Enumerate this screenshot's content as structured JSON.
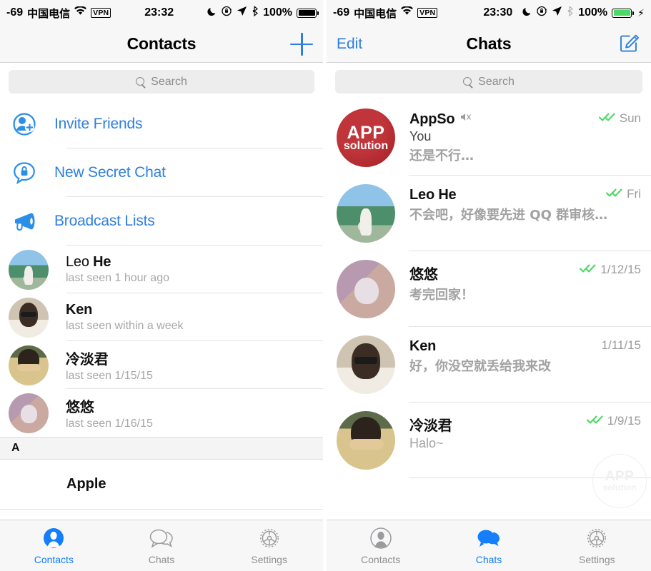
{
  "left": {
    "status": {
      "signal": "-69",
      "carrier": "中国电信",
      "wifi_icon": "wifi-icon",
      "vpn": "VPN",
      "time": "23:32",
      "moon_icon": "moon-icon",
      "lock_rotation_icon": "rotation-lock-icon",
      "location_icon": "location-arrow-icon",
      "bluetooth_icon": "bluetooth-icon",
      "battery_percent": "100%",
      "battery_state": "full"
    },
    "nav": {
      "title": "Contacts",
      "right_action": "add-contact"
    },
    "search": {
      "placeholder": "Search",
      "value": ""
    },
    "actions": [
      {
        "label": "Invite Friends",
        "icon": "add-person-icon"
      },
      {
        "label": "New Secret Chat",
        "icon": "secret-chat-lock-icon"
      },
      {
        "label": "Broadcast Lists",
        "icon": "megaphone-icon"
      }
    ],
    "contacts": [
      {
        "name_first": "Leo",
        "name_last": "He",
        "status": "last seen 1 hour ago",
        "avatar": "ph-leo"
      },
      {
        "name_first": "Ken",
        "name_last": "",
        "status": "last seen within a week",
        "avatar": "ph-ken"
      },
      {
        "name_first": "冷淡君",
        "name_last": "",
        "status": "last seen 1/15/15",
        "avatar": "ph-leng"
      },
      {
        "name_first": "悠悠",
        "name_last": "",
        "status": "last seen 1/16/15",
        "avatar": "ph-cat"
      }
    ],
    "section_letter": "A",
    "section_first_entry": "Apple",
    "tabs": [
      {
        "label": "Contacts",
        "icon": "person-icon",
        "active": true
      },
      {
        "label": "Chats",
        "icon": "chat-bubbles-icon",
        "active": false
      },
      {
        "label": "Settings",
        "icon": "gear-icon",
        "active": false
      }
    ]
  },
  "right": {
    "status": {
      "signal": "-69",
      "carrier": "中国电信",
      "wifi_icon": "wifi-icon",
      "vpn": "VPN",
      "time": "23:30",
      "moon_icon": "moon-icon",
      "lock_rotation_icon": "rotation-lock-icon",
      "location_icon": "location-arrow-icon",
      "bluetooth_icon": "bluetooth-icon",
      "battery_percent": "100%",
      "battery_state": "charging"
    },
    "nav": {
      "left_button": "Edit",
      "title": "Chats",
      "right_action": "compose"
    },
    "search": {
      "placeholder": "Search",
      "value": ""
    },
    "chats": [
      {
        "name": "AppSo",
        "muted": true,
        "sender": "You",
        "preview": "还是不行…",
        "date": "Sun",
        "read_ticks": "double-check-green",
        "avatar": "ph-appso",
        "avatar_text_1": "APP",
        "avatar_text_2": "solution"
      },
      {
        "name": "Leo He",
        "muted": false,
        "sender": "",
        "preview": "不会吧，好像要先进 QQ 群审核…",
        "date": "Fri",
        "read_ticks": "double-check-green",
        "avatar": "ph-leo"
      },
      {
        "name": "悠悠",
        "muted": false,
        "sender": "",
        "preview": "考完回家！",
        "date": "1/12/15",
        "read_ticks": "double-check-green",
        "avatar": "ph-cat"
      },
      {
        "name": "Ken",
        "muted": false,
        "sender": "",
        "preview": "好，你没空就丢给我来改",
        "date": "1/11/15",
        "read_ticks": "none",
        "avatar": "ph-ken"
      },
      {
        "name": "冷淡君",
        "muted": false,
        "sender": "",
        "preview": "Halo~",
        "date": "1/9/15",
        "read_ticks": "double-check-green",
        "avatar": "ph-leng"
      }
    ],
    "watermark": {
      "line1": "APP",
      "line2": "solution"
    },
    "tabs": [
      {
        "label": "Contacts",
        "icon": "person-icon",
        "active": false
      },
      {
        "label": "Chats",
        "icon": "chat-bubbles-icon",
        "active": true
      },
      {
        "label": "Settings",
        "icon": "gear-icon",
        "active": false
      }
    ]
  },
  "colors": {
    "accent_blue": "#147efb",
    "link_blue": "#2f7fe0",
    "tick_green": "#4cd964",
    "muted_gray": "#8e8e93",
    "bar_bg": "#f7f7f7"
  }
}
